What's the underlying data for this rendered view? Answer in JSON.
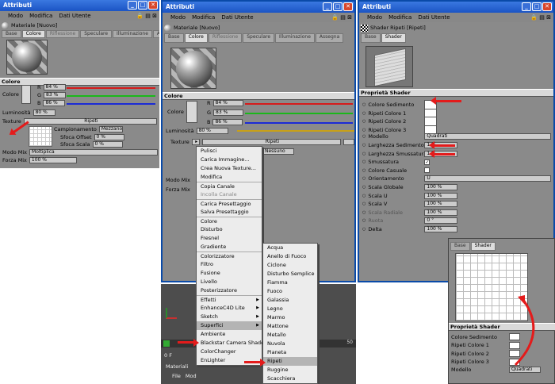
{
  "win1": {
    "title": "Attributi",
    "menu": [
      "Modo",
      "Modifica",
      "Dati Utente"
    ],
    "material": "Materiale [Nuovo]",
    "tabs": [
      "Base",
      "Colore",
      "Riflessione",
      "Speculare",
      "Illuminazione",
      "Assegna"
    ],
    "section": "Colore",
    "colore_label": "Colore",
    "rgb": [
      {
        "ch": "R",
        "val": "84 %"
      },
      {
        "ch": "G",
        "val": "83 %"
      },
      {
        "ch": "B",
        "val": "86 %"
      }
    ],
    "luminosita": "Luminosità",
    "lum_val": "80 %",
    "texture_label": "Texture",
    "texture_name": "Ripeti",
    "campionamento": "Campionamento",
    "camp_val": "Mezzano",
    "sfoca_offset": "Sfoca Offset",
    "so_val": "0 %",
    "sfoca_scala": "Sfoca Scala",
    "ss_val": "0 %",
    "modo_mix": "Modo Mix",
    "mm_val": "Moltiplica",
    "forza_mix": "Forza Mix",
    "fm_val": "100 %"
  },
  "win2": {
    "title": "Attributi",
    "menu": [
      "Modo",
      "Modifica",
      "Dati Utente"
    ],
    "material": "Materiale [Nuovo]",
    "tabs": [
      "Base",
      "Colore",
      "Riflessione",
      "Speculare",
      "Illuminazione",
      "Assegna"
    ],
    "section": "Colore",
    "colore_label": "Colore",
    "rgb": [
      {
        "ch": "R",
        "val": "84 %"
      },
      {
        "ch": "G",
        "val": "83 %"
      },
      {
        "ch": "B",
        "val": "86 %"
      }
    ],
    "luminosita": "Luminosità",
    "lum_val": "80 %",
    "texture_label": "Texture",
    "texture_name": "Ripeti",
    "camp_val": "Nessuno",
    "modo_mix": "Modo Mix",
    "forza_mix": "Forza Mix"
  },
  "menu1": [
    "Pulisci",
    "Carica Immagine...",
    "Crea Nuova Texture...",
    "Modifica",
    "Copia Canale",
    "Incolla Canale",
    "Carica Presettaggio",
    "Salva Presettaggio",
    "Colore",
    "Disturbo",
    "Fresnel",
    "Gradiente",
    "Colorizzatore",
    "Filtro",
    "Fusione",
    "Livello",
    "Posterizzatore",
    "Effetti",
    "EnhanceC4D Lite",
    "Sketch",
    "Superfici",
    "Ambiente",
    "Blackstar Camera Shader",
    "ColorChanger",
    "EnLighter"
  ],
  "menu2": [
    "Acqua",
    "Anello di Fuoco",
    "Ciclone",
    "Disturbo Semplice",
    "Fiamma",
    "Fuoco",
    "Galassia",
    "Legno",
    "Marmo",
    "Mattone",
    "Metallo",
    "Nuvola",
    "Pianeta",
    "Ripeti",
    "Ruggine",
    "Scacchiera"
  ],
  "win3": {
    "title": "Attributi",
    "menu": [
      "Modo",
      "Modifica",
      "Dati Utente"
    ],
    "shader": "Shader Ripeti [Ripeti]",
    "tabs": [
      "Base",
      "Shader"
    ],
    "section": "Proprietà Shader",
    "props": [
      {
        "label": "Colore Sedimento",
        "type": "swatch"
      },
      {
        "label": "Ripeti Colore 1",
        "type": "swatch"
      },
      {
        "label": "Ripeti Colore 2",
        "type": "swatch"
      },
      {
        "label": "Ripeti Colore 3",
        "type": "swatch"
      },
      {
        "label": "Modello",
        "type": "select",
        "val": "Quadrati"
      },
      {
        "label": "Larghezza Sedimento",
        "type": "field",
        "val": "1 %"
      },
      {
        "label": "Larghezza Smussatura",
        "type": "field",
        "val": "1 %"
      },
      {
        "label": "Smussatura",
        "type": "check",
        "val": "✓"
      },
      {
        "label": "Colore Casuale",
        "type": "check",
        "val": ""
      },
      {
        "label": "Orientamento",
        "type": "select",
        "val": "U"
      },
      {
        "label": "Scala Globale",
        "type": "field",
        "val": "100 %"
      },
      {
        "label": "Scala U",
        "type": "field",
        "val": "100 %"
      },
      {
        "label": "Scala V",
        "type": "field",
        "val": "100 %"
      },
      {
        "label": "Scala Radiale",
        "type": "field",
        "val": "100 %"
      },
      {
        "label": "Ruota",
        "type": "field",
        "val": "0 °"
      },
      {
        "label": "Delta",
        "type": "field",
        "val": "100 %"
      }
    ]
  },
  "inset": {
    "tabs": [
      "Base",
      "Shader"
    ],
    "section": "Proprietà Shader",
    "props": [
      "Colore Sedimento",
      "Ripeti Colore 1",
      "Ripeti Colore 2",
      "Ripeti Colore 3",
      "Modello"
    ],
    "modello_val": "Quadrati"
  },
  "bottom": {
    "frame_label": "0 F",
    "frame_end": "50",
    "mat_label": "Materiali",
    "menu": [
      "File",
      "Mod"
    ]
  },
  "colors": {
    "arrow": "#e41b1b",
    "title": "#1b54c4"
  }
}
